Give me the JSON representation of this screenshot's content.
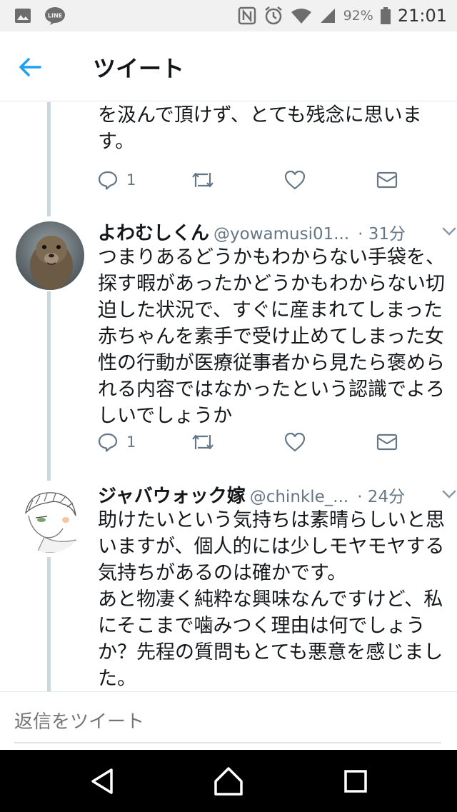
{
  "status_bar": {
    "battery": "92%",
    "time": "21:01",
    "left_icons": [
      "gallery-icon",
      "line-app-icon"
    ],
    "right_icons": [
      "nfc-icon",
      "alarm-icon",
      "wifi-icon",
      "signal-icon",
      "battery-icon"
    ]
  },
  "header": {
    "title": "ツイート"
  },
  "tweets": [
    {
      "text": "を汲んで頂けず、とても残念に思いま\nす。",
      "reply_count": "1"
    },
    {
      "name": "よわむしくん",
      "handle": "@yowamusi01...",
      "time": "· 31分",
      "text": "つまりあるどうかもわからない手袋を、\n探す暇があったかどうかもわからない切\n迫した状況で、すぐに産まれてしまった\n赤ちゃんを素手で受け止めてしまった女\n性の行動が医療従事者から見たら褒めら\nれる内容ではなかったという認識でよろ\nしいでしょうか",
      "reply_count": "1"
    },
    {
      "name": "ジャバウォック嫁",
      "handle": "@chinkle_...",
      "time": "· 24分",
      "text": "助けたいという気持ちは素晴らしいと思\nいますが、個人的には少しモヤモヤする\n気持ちがあるのは確かです。\nあと物凄く純粋な興味なんですけど、私\nにそこまで噛みつく理由は何でしょう\nか？先程の質問もとても悪意を感じまし\nた。"
    }
  ],
  "reply_bar": {
    "placeholder": "返信をツイート"
  },
  "colors": {
    "accent": "#1da1f2",
    "secondary_text": "#657786",
    "thread_line": "#ccd6dd"
  }
}
